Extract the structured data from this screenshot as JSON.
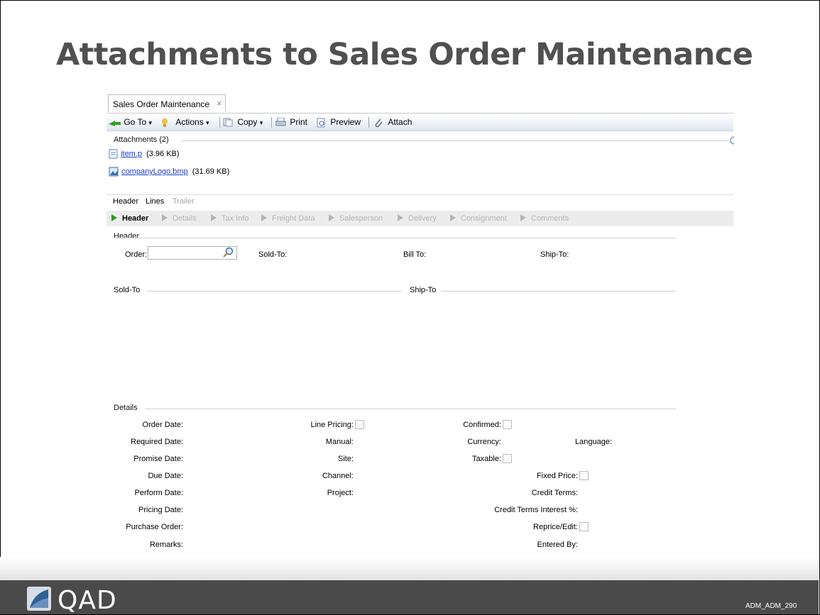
{
  "slide": {
    "title": "Attachments to Sales Order Maintenance",
    "logo": "QAD",
    "code": "ADM_ADM_290"
  },
  "window": {
    "tab_label": "Sales Order Maintenance",
    "tab_close": "×"
  },
  "toolbar": {
    "goto_label": "Go To",
    "actions_label": "Actions",
    "copy_label": "Copy",
    "print_label": "Print",
    "preview_label": "Preview",
    "attach_label": "Attach",
    "dropdown_glyph": "▾"
  },
  "attachments": {
    "header": "Attachments (2)",
    "items": [
      {
        "name": "item.p",
        "size": "(3.96 KB)",
        "icon": "text-file-icon"
      },
      {
        "name": "companyLogo.bmp",
        "size": "(31.69 KB)",
        "icon": "image-file-icon"
      }
    ]
  },
  "subtabs": [
    "Header",
    "Lines",
    "Trailer"
  ],
  "steps": [
    "Header",
    "Details",
    "Tax Info",
    "Freight Data",
    "Salesperson",
    "Delivery",
    "Consignment",
    "Comments"
  ],
  "header_section": {
    "title": "Header",
    "order_label": "Order:",
    "order_value": "",
    "sold_to_label": "Sold-To:",
    "bill_to_label": "Bill To:",
    "ship_to_label": "Ship-To:",
    "sold_to_group": "Sold-To",
    "ship_to_group": "Ship-To"
  },
  "details": {
    "title": "Details",
    "col1": [
      "Order Date:",
      "Required Date:",
      "Promise Date:",
      "Due Date:",
      "Perform Date:",
      "Pricing Date:",
      "Purchase Order:",
      "Remarks:"
    ],
    "col2": [
      "Line Pricing:",
      "Manual:",
      "Site:",
      "Channel:",
      "Project:"
    ],
    "col3": [
      "Confirmed:",
      "Currency:",
      "Taxable:"
    ],
    "language_label": "Language:",
    "col4": [
      "Fixed Price:",
      "Credit Terms:",
      "Credit Terms Interest %:",
      "Reprice/Edit:",
      "Entered By:"
    ]
  }
}
